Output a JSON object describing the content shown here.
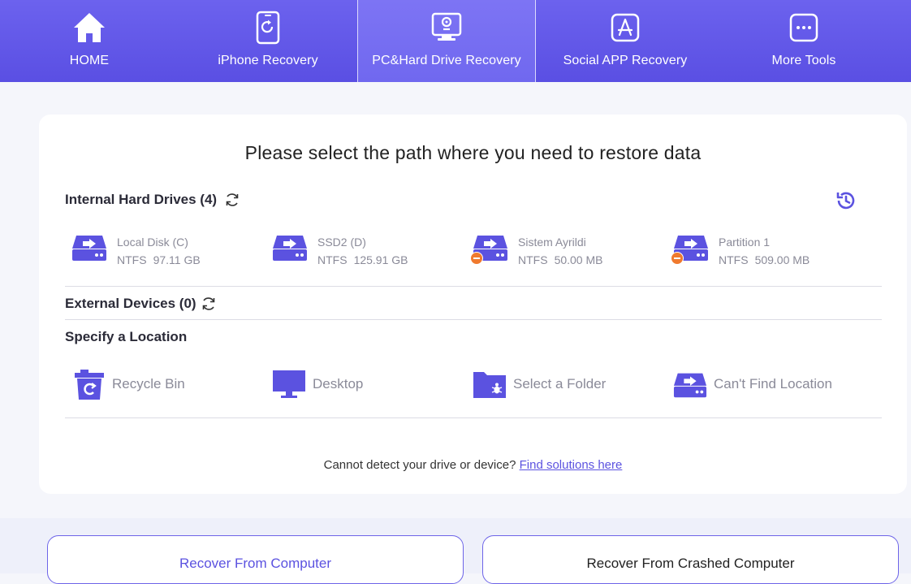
{
  "nav": {
    "tabs": [
      {
        "label": "HOME",
        "icon": "home-icon"
      },
      {
        "label": "iPhone Recovery",
        "icon": "iphone-recovery-icon"
      },
      {
        "label": "PC&Hard Drive Recovery",
        "icon": "hard-drive-recovery-icon",
        "active": true
      },
      {
        "label": "Social APP Recovery",
        "icon": "app-store-icon"
      },
      {
        "label": "More Tools",
        "icon": "more-tools-icon"
      }
    ]
  },
  "main": {
    "title": "Please select the path where you need to restore data",
    "internal": {
      "heading": "Internal Hard Drives (4)",
      "drives": [
        {
          "name": "Local Disk (C)",
          "fs": "NTFS",
          "size": "97.11 GB",
          "warning": false
        },
        {
          "name": "SSD2 (D)",
          "fs": "NTFS",
          "size": "125.91 GB",
          "warning": false
        },
        {
          "name": "Sistem Ayrildi",
          "fs": "NTFS",
          "size": "50.00 MB",
          "warning": true
        },
        {
          "name": "Partition 1",
          "fs": "NTFS",
          "size": "509.00 MB",
          "warning": true
        }
      ]
    },
    "external": {
      "heading": "External Devices (0)"
    },
    "location": {
      "heading": "Specify a Location",
      "items": [
        {
          "label": "Recycle Bin",
          "icon": "recycle-bin-icon"
        },
        {
          "label": "Desktop",
          "icon": "desktop-icon"
        },
        {
          "label": "Select a Folder",
          "icon": "folder-icon"
        },
        {
          "label": "Can't Find Location",
          "icon": "drive-icon"
        }
      ]
    },
    "footer": {
      "text": "Cannot detect your drive or device?",
      "link": "Find solutions here"
    }
  },
  "bottom": {
    "left_button": "Recover From Computer",
    "right_button": "Recover From Crashed Computer"
  },
  "colors": {
    "accent": "#5b52e0",
    "nav_bg": "#6c62ee",
    "warning": "#f07a2e",
    "muted_text": "#8a8a98"
  }
}
